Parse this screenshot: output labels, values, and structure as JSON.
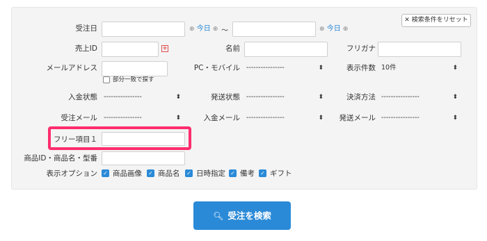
{
  "reset_button": {
    "label": "✕ 検索条件をリセット"
  },
  "order_date": {
    "label": "受注日",
    "today_label": "今日",
    "range_sep": "〜",
    "plus": "⊕"
  },
  "sales_id": {
    "label": "売上ID"
  },
  "name": {
    "label": "名前"
  },
  "furigana": {
    "label": "フリガナ"
  },
  "email": {
    "label": "メールアドレス",
    "partial_match": "部分一致で探す"
  },
  "pc_mobile": {
    "label": "PC・モバイル",
    "value": "----------------"
  },
  "display_count": {
    "label": "表示件数",
    "value": "10件"
  },
  "payment_status": {
    "label": "入金状態",
    "value": "----------------"
  },
  "shipping_status": {
    "label": "発送状態",
    "value": "----------------"
  },
  "payment_method": {
    "label": "決済方法",
    "value": "----------------"
  },
  "order_mail": {
    "label": "受注メール",
    "value": "----------------"
  },
  "payment_mail": {
    "label": "入金メール",
    "value": "----------------"
  },
  "shipping_mail": {
    "label": "発送メール",
    "value": "----------------"
  },
  "free_item": {
    "label": "フリー項目１"
  },
  "product": {
    "label": "商品ID・商品名・型番"
  },
  "display_options": {
    "label": "表示オプション",
    "items": [
      "商品画像",
      "商品名",
      "日時指定",
      "備考",
      "ギフト"
    ]
  },
  "search_button": {
    "label": "受注を検索",
    "icon": "search-icon"
  },
  "colors": {
    "accent": "#2a8ad8",
    "highlight": "#ff2d6e",
    "panel": "#f4f4f4"
  }
}
